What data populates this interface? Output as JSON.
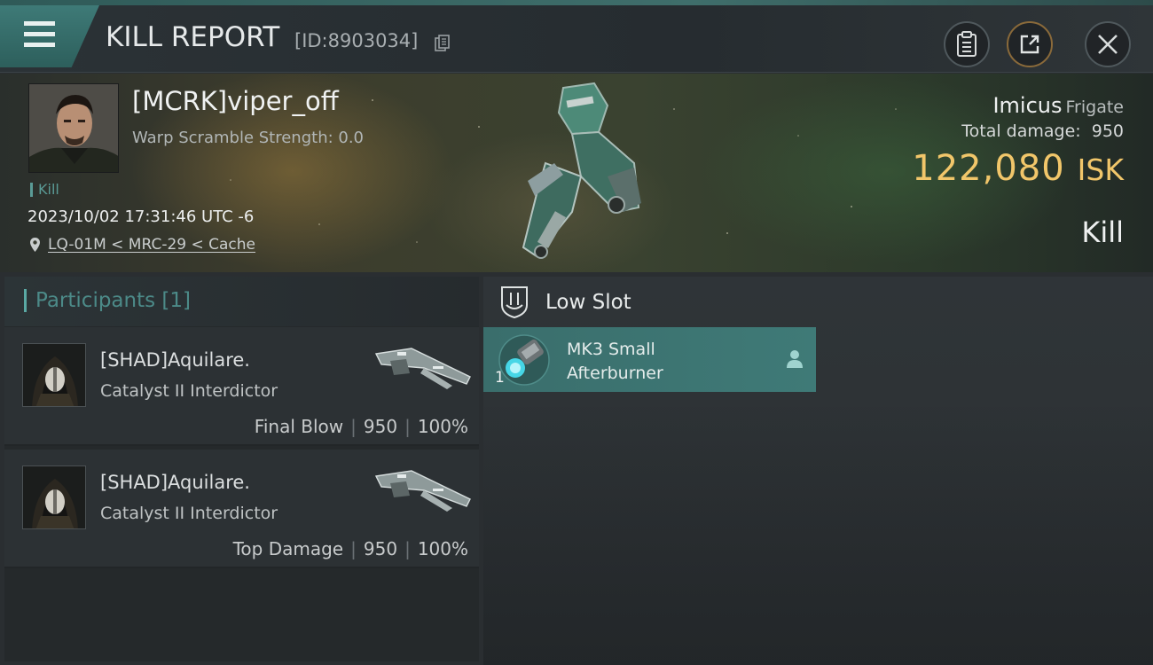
{
  "header": {
    "title": "KILL REPORT",
    "report_id": "[ID:8903034]"
  },
  "victim": {
    "name": "[MCRK]viper_off",
    "warp_scramble": "Warp Scramble Strength: 0.0",
    "tag": "Kill",
    "datetime": "2023/10/02 17:31:46 UTC -6",
    "location": "LQ-01M < MRC-29 < Cache",
    "ship_name": "Imicus",
    "ship_class": "Frigate",
    "total_damage_label": "Total damage:",
    "total_damage": "950",
    "isk_value": "122,080",
    "isk_unit": "ISK",
    "result": "Kill"
  },
  "participants": {
    "title": "Participants [1]",
    "rows": [
      {
        "name": "[SHAD]Aquilare.",
        "ship": "Catalyst II Interdictor",
        "role": "Final Blow",
        "damage": "950",
        "percent": "100%"
      },
      {
        "name": "[SHAD]Aquilare.",
        "ship": "Catalyst II Interdictor",
        "role": "Top Damage",
        "damage": "950",
        "percent": "100%"
      }
    ]
  },
  "slots": {
    "title": "Low Slot",
    "items": [
      {
        "name_line1": "MK3 Small",
        "name_line2": "Afterburner",
        "qty": "1"
      }
    ]
  },
  "icons": {
    "menu": "menu-icon",
    "copy": "copy-icon",
    "notes": "clipboard-icon",
    "share": "share-icon",
    "close": "close-icon",
    "location": "location-pin-icon",
    "slot": "low-slot-icon",
    "person": "person-icon"
  },
  "colors": {
    "accent_teal": "#3f7a77",
    "isk_gold": "#f1c66a",
    "participants_title": "#4c8a88"
  }
}
